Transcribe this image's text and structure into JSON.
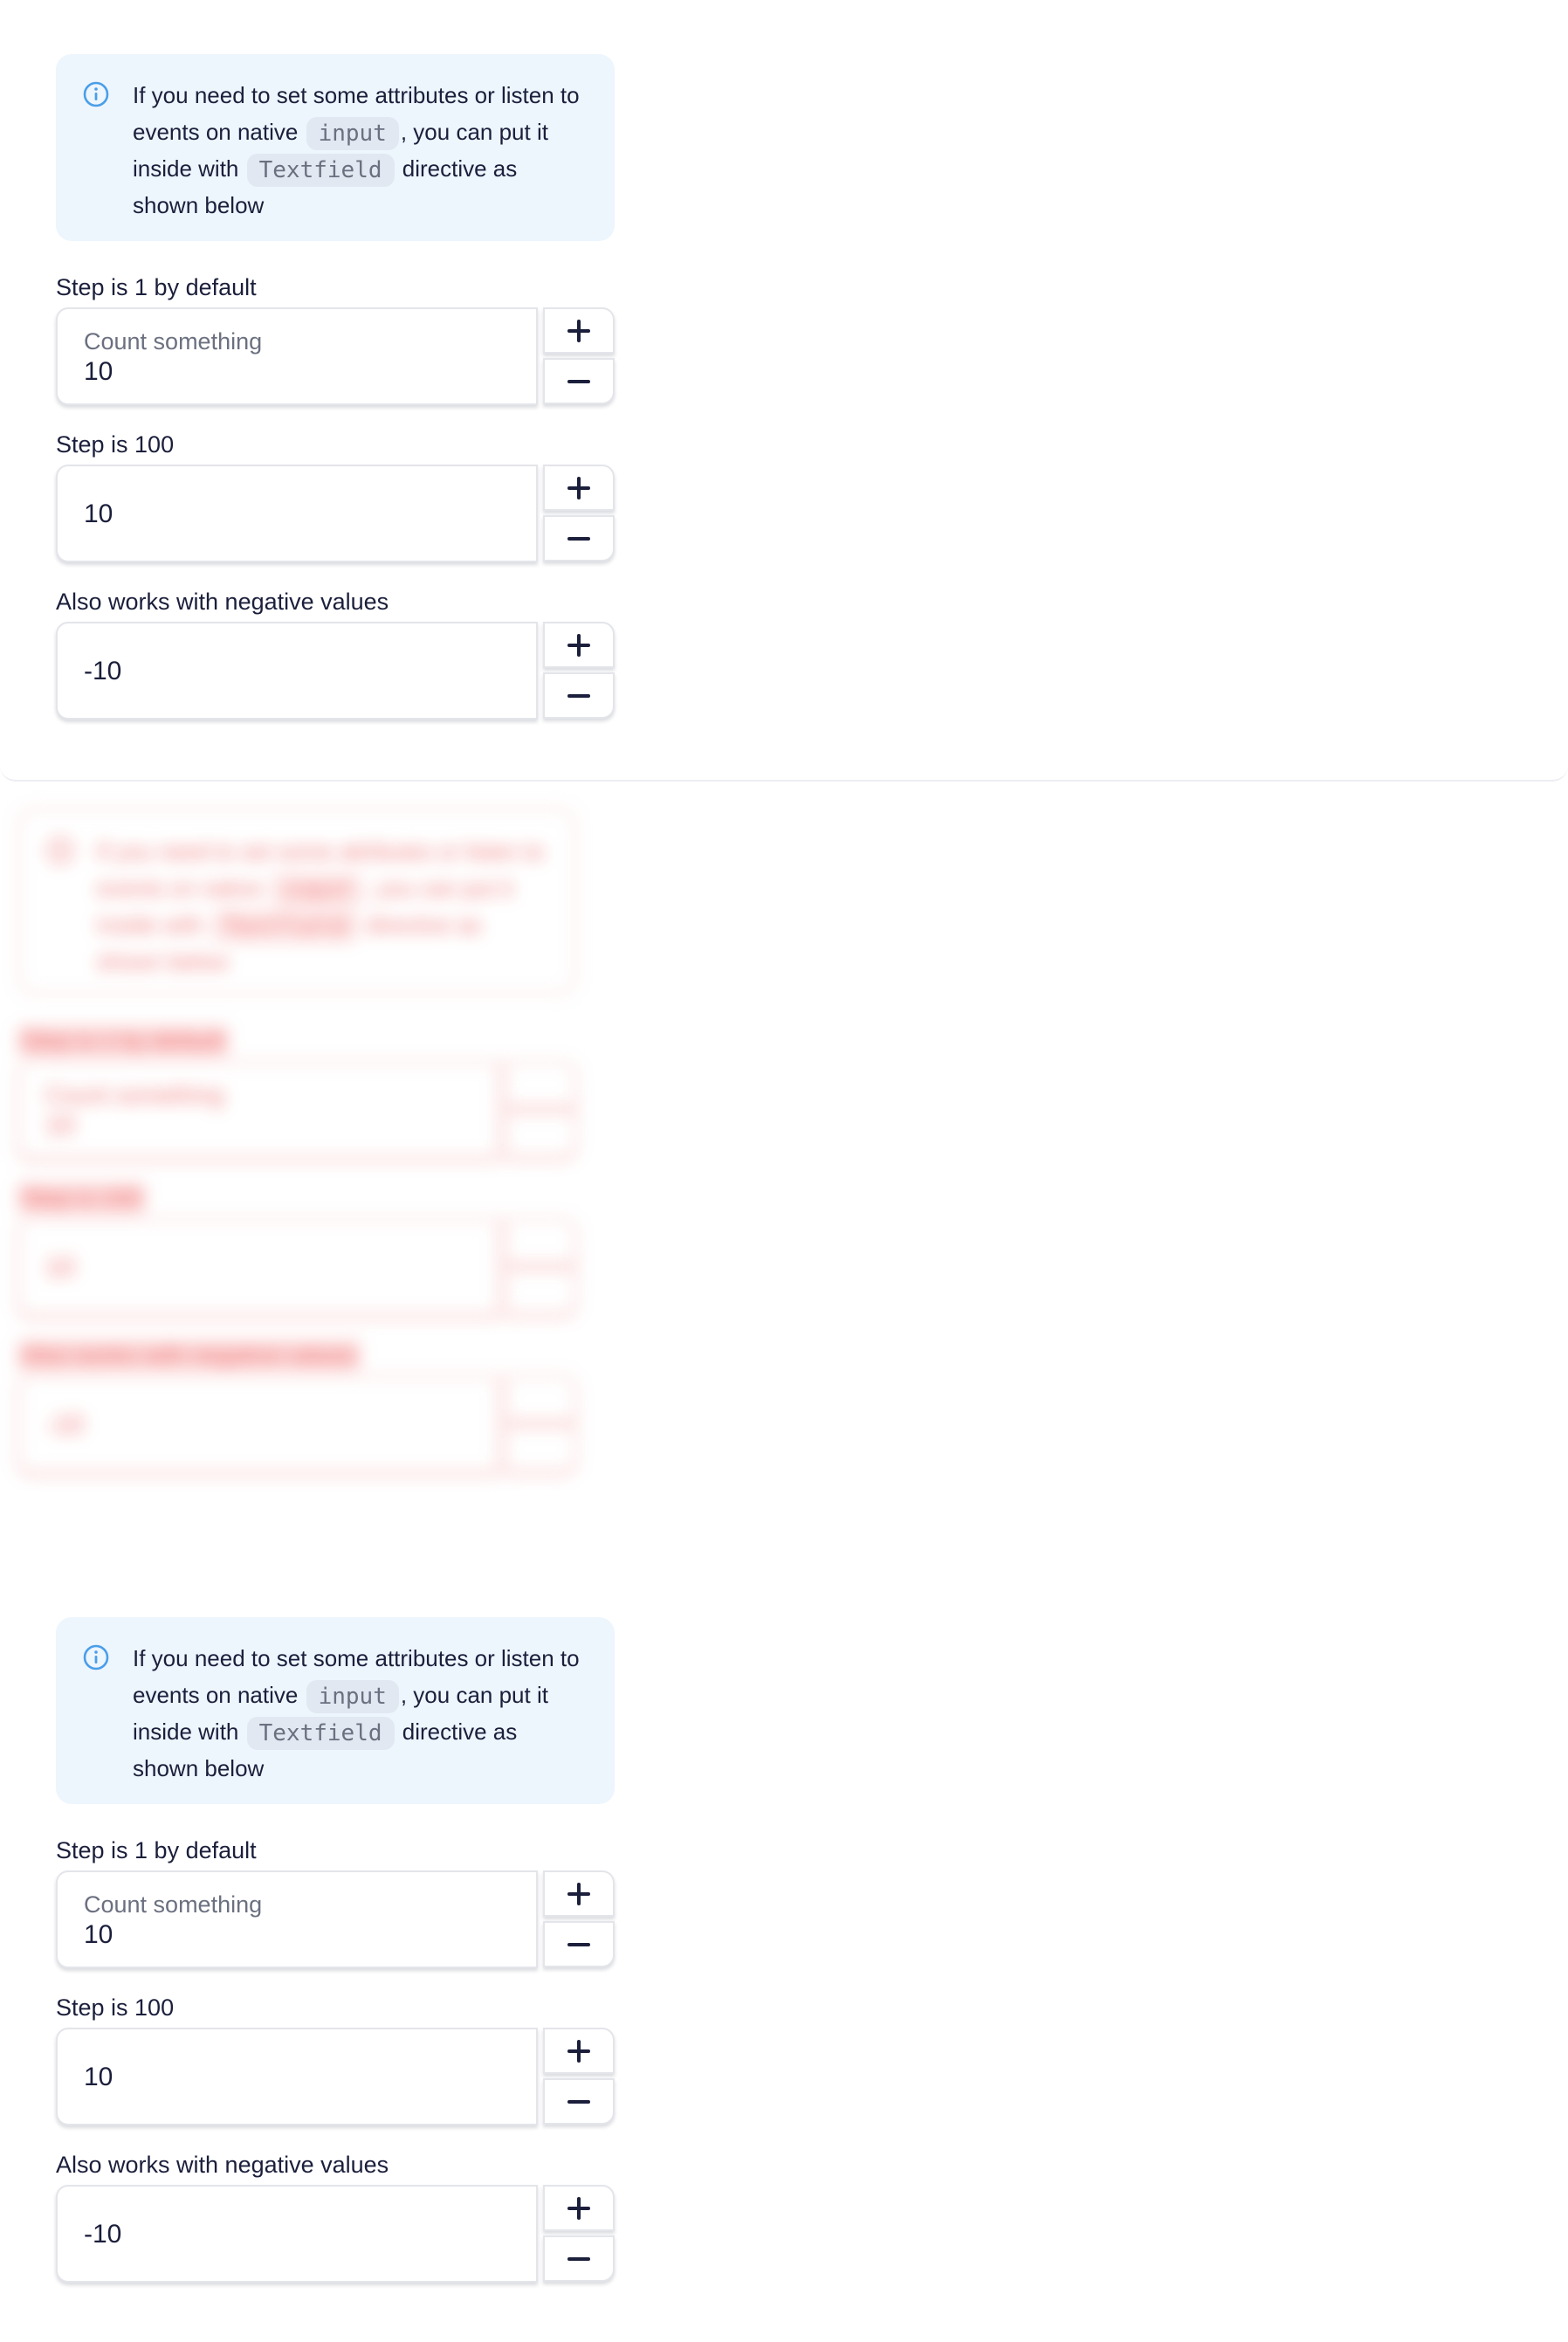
{
  "notification": {
    "icon": "info-icon",
    "accent_color": "#4a9ee8",
    "text_before_input": "If you need to set some attributes or listen to events on native ",
    "code_input": "input",
    "text_between": ", you can put it inside with ",
    "code_textfield": "Textfield",
    "text_after": " directive as shown below"
  },
  "fields": [
    {
      "label": "Step is 1 by default",
      "placeholder": "Count something",
      "value": "10",
      "plus_label": "+",
      "minus_label": "−"
    },
    {
      "label": "Step is 100",
      "placeholder": "",
      "value": "10",
      "plus_label": "+",
      "minus_label": "−"
    },
    {
      "label": "Also works with negative values",
      "placeholder": "",
      "value": "-10",
      "plus_label": "+",
      "minus_label": "−"
    }
  ],
  "diff_highlight_color": "#f06a6a"
}
